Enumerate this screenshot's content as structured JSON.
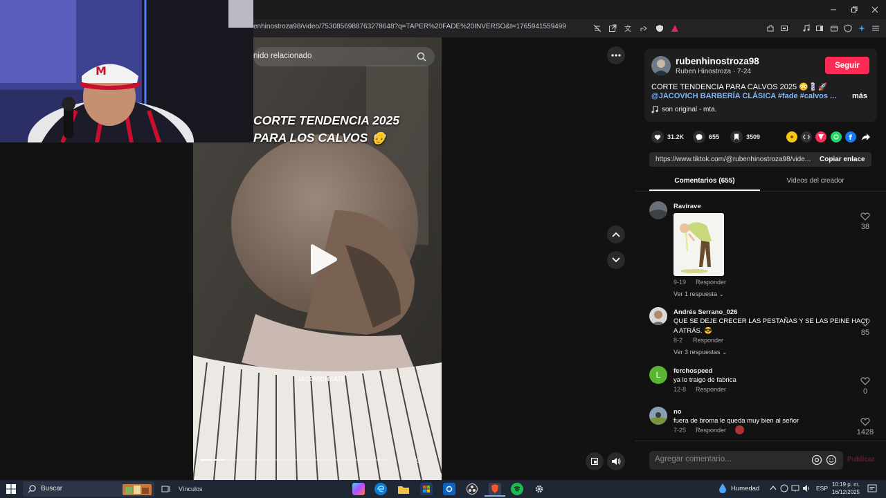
{
  "browser": {
    "url": "enhinostroza98/video/7530856988763278648?q=TAPER%20FADE%20INVERSO&t=1765941559499"
  },
  "video": {
    "search_placeholder": "nido relacionado",
    "overlay_title_line1": "CORTE TENDENCIA 2025",
    "overlay_title_line2": "PARA LOS CALVOS 👴",
    "watermark": "JACOVICHEATE",
    "time": "00:02/00:17",
    "progress": 0.13
  },
  "post": {
    "username": "rubenhinostroza98",
    "display_sub": "Ruben Hinostroza · 7-24",
    "follow_label": "Seguir",
    "caption": "CORTE TENDENCIA PARA CALVOS 2025 😳💈🚀",
    "tags": "@JACOVICH BARBERÍA CLÁSICA #fade #calvos ...",
    "more_label": "más",
    "music": "son original - mta.",
    "likes": "31.2K",
    "comments": "655",
    "saves": "3509",
    "link": "https://www.tiktok.com/@rubenhinostroza98/vide...",
    "copy_label": "Copiar enlace"
  },
  "tabs": {
    "comments": "Comentarios (655)",
    "videos": "Videos del creador"
  },
  "comments": [
    {
      "user": "Ravirave",
      "text": "",
      "meta": "9-19",
      "reply": "Responder",
      "more": "Ver 1 respuesta ⌄",
      "likes": "38"
    },
    {
      "user": "Andrés Serrano_026",
      "text1": "QUE SE DEJE CRECER LAS PESTAÑAS Y SE LAS PEINE HACI",
      "text2": "A ATRÁS. 😎",
      "meta": "8-2",
      "reply": "Responder",
      "more": "Ver 3 respuestas ⌄",
      "likes": "85"
    },
    {
      "user": "ferchospeed",
      "text": "ya lo traigo de fabrica",
      "meta": "12-8",
      "reply": "Responder",
      "likes": "0",
      "avatar_letter": "L"
    },
    {
      "user": "no",
      "text": "fuera de broma le queda muy bien al señor",
      "meta": "7-25",
      "reply": "Responder",
      "likes": "1428"
    }
  ],
  "comment_input": {
    "placeholder": "Agregar comentario...",
    "publish_label": "Publicar"
  },
  "taskbar": {
    "search_label": "Buscar",
    "links_label": "Vínculos",
    "weather": "Humedad",
    "lang": "ESP",
    "time": "10:19 p. m.",
    "date": "16/12/2025"
  },
  "colors": {
    "accent": "#fe2c55",
    "link": "#7fb7ff"
  }
}
